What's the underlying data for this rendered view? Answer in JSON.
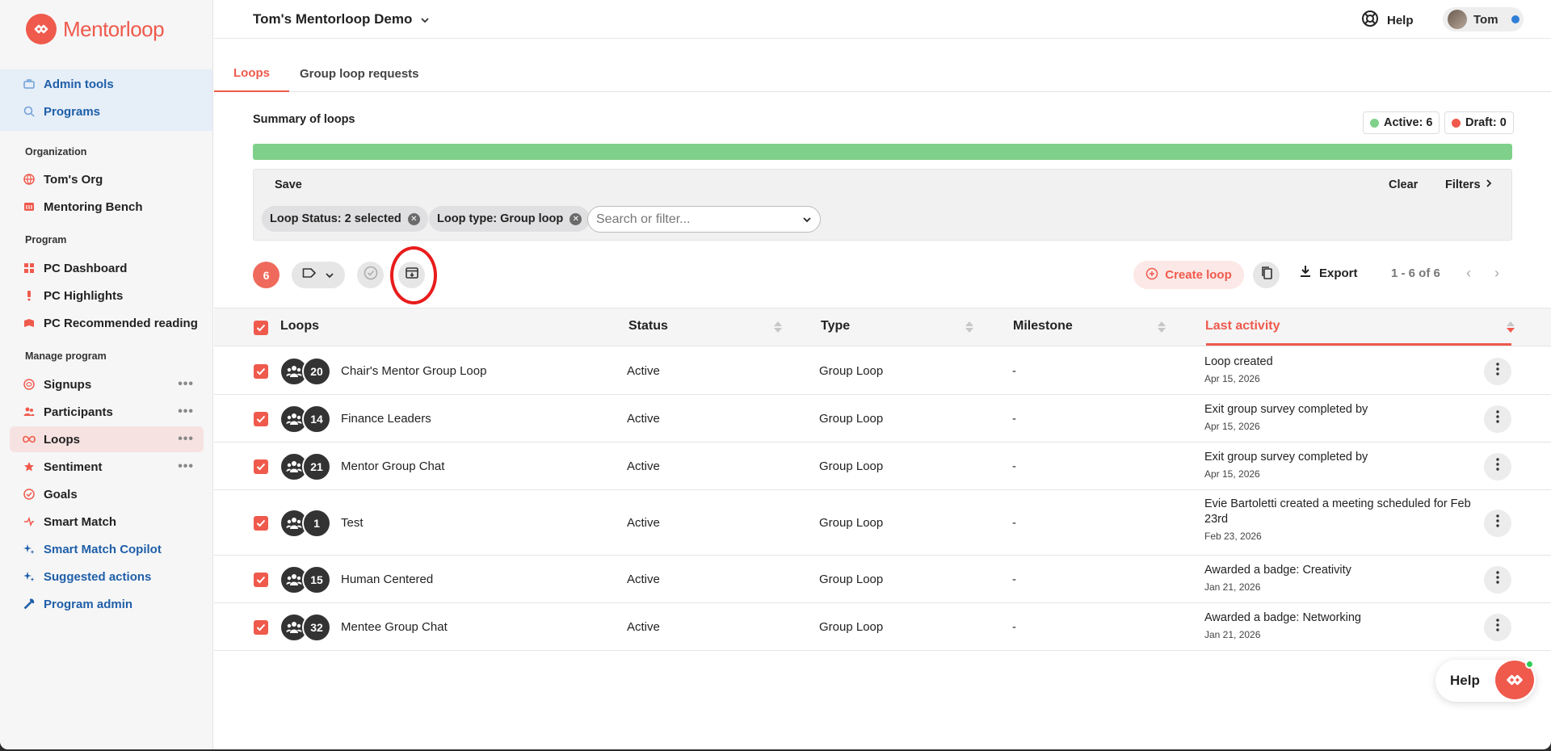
{
  "brand": {
    "name": "Mentorloop",
    "accent": "#ef5a4c"
  },
  "sidebar": {
    "top_items": [
      {
        "label": "Admin tools",
        "icon": "admin-tools-icon"
      },
      {
        "label": "Programs",
        "icon": "programs-icon"
      }
    ],
    "organization_heading": "Organization",
    "organization_items": [
      {
        "label": "Tom's Org",
        "icon": "globe-icon"
      },
      {
        "label": "Mentoring Bench",
        "icon": "bench-icon"
      }
    ],
    "program_heading": "Program",
    "program_items": [
      {
        "label": "PC Dashboard",
        "icon": "dashboard-icon"
      },
      {
        "label": "PC Highlights",
        "icon": "highlights-icon"
      },
      {
        "label": "PC Recommended reading",
        "icon": "reading-icon"
      }
    ],
    "manage_heading": "Manage program",
    "manage_items": [
      {
        "label": "Signups",
        "icon": "signups-icon"
      },
      {
        "label": "Participants",
        "icon": "participants-icon"
      },
      {
        "label": "Loops",
        "icon": "loops-icon"
      },
      {
        "label": "Sentiment",
        "icon": "star-icon"
      },
      {
        "label": "Goals",
        "icon": "goals-icon"
      },
      {
        "label": "Smart Match",
        "icon": "smart-match-icon"
      },
      {
        "label": "Smart Match Copilot",
        "icon": "sparkle-icon"
      },
      {
        "label": "Suggested actions",
        "icon": "sparkle-icon"
      },
      {
        "label": "Program admin",
        "icon": "wrench-icon"
      }
    ]
  },
  "header": {
    "org_title": "Tom's Mentorloop Demo",
    "help_label": "Help",
    "user_name": "Tom"
  },
  "tabs": [
    {
      "label": "Loops"
    },
    {
      "label": "Group loop requests"
    }
  ],
  "summary": {
    "title": "Summary of loops",
    "active_label": "Active: 6",
    "draft_label": "Draft: 0",
    "active_fraction": 1.0,
    "active_color": "#7fd08a",
    "draft_color": "#ef5a4c"
  },
  "filters": {
    "save_label": "Save",
    "clear_label": "Clear",
    "filters_label": "Filters",
    "chips": [
      "Loop Status: 2 selected",
      "Loop type: Group loop"
    ],
    "search_placeholder": "Search or filter..."
  },
  "toolbar": {
    "selected_count": "6",
    "create_label": "Create loop",
    "export_label": "Export",
    "pager_label": "1 - 6 of 6"
  },
  "table": {
    "columns": [
      "Loops",
      "Status",
      "Type",
      "Milestone",
      "Last activity"
    ],
    "rows": [
      {
        "count": "20",
        "name": "Chair's Mentor Group Loop",
        "status": "Active",
        "type": "Group Loop",
        "milestone": "-",
        "activity": "Loop created",
        "date": "Apr 15, 2026"
      },
      {
        "count": "14",
        "name": "Finance Leaders",
        "status": "Active",
        "type": "Group Loop",
        "milestone": "-",
        "activity": "Exit group survey completed by",
        "date": "Apr 15, 2026"
      },
      {
        "count": "21",
        "name": "Mentor Group Chat",
        "status": "Active",
        "type": "Group Loop",
        "milestone": "-",
        "activity": "Exit group survey completed by",
        "date": "Apr 15, 2026"
      },
      {
        "count": "1",
        "name": "Test",
        "status": "Active",
        "type": "Group Loop",
        "milestone": "-",
        "activity": "Evie Bartoletti created a meeting scheduled for Feb 23rd",
        "date": "Feb 23, 2026"
      },
      {
        "count": "15",
        "name": "Human Centered",
        "status": "Active",
        "type": "Group Loop",
        "milestone": "-",
        "activity": "Awarded a badge: Creativity",
        "date": "Jan 21, 2026"
      },
      {
        "count": "32",
        "name": "Mentee Group Chat",
        "status": "Active",
        "type": "Group Loop",
        "milestone": "-",
        "activity": "Awarded a badge: Networking",
        "date": "Jan 21, 2026"
      }
    ]
  },
  "help_widget": {
    "label": "Help"
  }
}
